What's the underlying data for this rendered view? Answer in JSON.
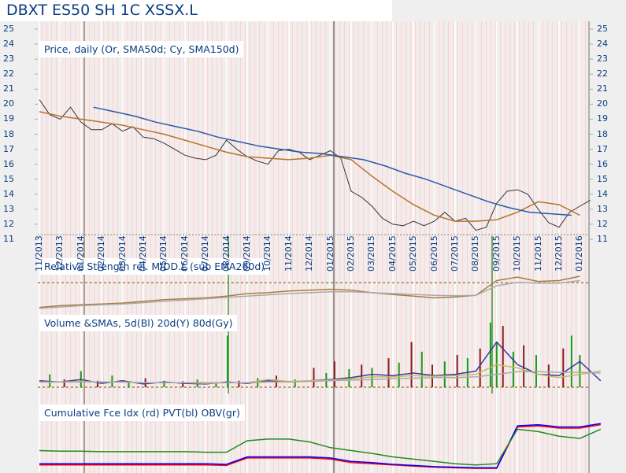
{
  "title": "DBXT ES50 SH 1C XSSX.L",
  "chart_data": [
    {
      "type": "line",
      "title": "Price, daily (Or, SMA50d; Cy, SMA150d)",
      "ylim": [
        11,
        25
      ],
      "yticks": [
        25,
        24,
        23,
        22,
        21,
        20,
        19,
        18,
        17,
        16,
        15,
        14,
        13,
        12,
        11
      ],
      "x_unit": "months since 11/2013",
      "xticks": [
        "11/2013",
        "12/2013",
        "01/2014",
        "02/2014",
        "03/2014",
        "04/2014",
        "05/2014",
        "06/2014",
        "07/2014",
        "08/2014",
        "09/2014",
        "10/2014",
        "11/2014",
        "12/2014",
        "01/2015",
        "02/2015",
        "03/2015",
        "04/2015",
        "05/2015",
        "06/2015",
        "07/2015",
        "08/2015",
        "09/2015",
        "10/2015",
        "11/2015",
        "12/2015",
        "01/2016"
      ],
      "series": [
        {
          "name": "Price",
          "color": "#333333",
          "t_start": 0,
          "t_step": 0.5,
          "values": [
            20.3,
            19.3,
            19.0,
            19.8,
            18.8,
            18.3,
            18.3,
            18.7,
            18.2,
            18.5,
            17.8,
            17.7,
            17.4,
            17.0,
            16.6,
            16.4,
            16.3,
            16.6,
            17.6,
            17.0,
            16.5,
            16.2,
            16.0,
            16.9,
            17.0,
            16.8,
            16.3,
            16.6,
            16.9,
            16.4,
            14.2,
            13.8,
            13.2,
            12.4,
            12.0,
            11.9,
            12.2,
            11.9,
            12.2,
            12.8,
            12.2,
            12.4,
            11.6,
            11.8,
            13.4,
            14.2,
            14.3,
            14.0,
            13.0,
            12.1,
            11.8,
            12.8,
            13.2,
            13.6
          ]
        },
        {
          "name": "SMA50d",
          "color": "#b8732a",
          "t_start": 0,
          "t_step": 1,
          "values": [
            19.5,
            19.2,
            19.0,
            18.8,
            18.6,
            18.3,
            18.0,
            17.6,
            17.2,
            16.8,
            16.5,
            16.4,
            16.3,
            16.4,
            16.6,
            16.3,
            15.2,
            14.2,
            13.3,
            12.6,
            12.2,
            12.2,
            12.3,
            12.8,
            13.5,
            13.3,
            12.6
          ]
        },
        {
          "name": "SMA150d",
          "color": "#2a5aa8",
          "t_start": 2.6,
          "t_step": 1,
          "values": [
            19.8,
            19.5,
            19.2,
            18.8,
            18.5,
            18.2,
            17.8,
            17.5,
            17.2,
            17.0,
            16.8,
            16.7,
            16.5,
            16.3,
            15.9,
            15.4,
            15.0,
            14.5,
            14.0,
            13.5,
            13.1,
            12.8,
            12.7,
            12.6
          ]
        }
      ],
      "reference_line": 11.3
    },
    {
      "type": "line",
      "title": "Relative Strength rel. MIDD.L (sub EMA260d)",
      "ylim": [
        0,
        100
      ],
      "reference_line": 65,
      "series": [
        {
          "name": "RS",
          "color": "#a87c3c",
          "t_start": 0,
          "t_step": 1,
          "values": [
            8,
            12,
            14,
            16,
            18,
            22,
            26,
            28,
            30,
            34,
            40,
            42,
            46,
            48,
            50,
            48,
            42,
            38,
            34,
            30,
            32,
            36,
            70,
            78,
            68,
            70,
            80
          ]
        },
        {
          "name": "EMA260d",
          "color": "#aaaaaa",
          "t_start": 0,
          "t_step": 1,
          "values": [
            6,
            9,
            12,
            14,
            16,
            19,
            22,
            25,
            28,
            31,
            34,
            37,
            40,
            42,
            44,
            44,
            42,
            40,
            38,
            36,
            35,
            36,
            58,
            66,
            64,
            64,
            70
          ]
        }
      ]
    },
    {
      "type": "bar",
      "title": "Volume &SMAs, 5d(Bl) 20d(Y) 80d(Gy)",
      "ylim": [
        0,
        100
      ],
      "bars": [
        [
          0.5,
          20,
          "up"
        ],
        [
          1.2,
          12,
          "down"
        ],
        [
          2.0,
          25,
          "up"
        ],
        [
          2.8,
          10,
          "down"
        ],
        [
          3.5,
          18,
          "up"
        ],
        [
          4.3,
          8,
          "up"
        ],
        [
          5.1,
          14,
          "down"
        ],
        [
          6.0,
          10,
          "up"
        ],
        [
          6.9,
          9,
          "down"
        ],
        [
          7.6,
          12,
          "up"
        ],
        [
          8.5,
          8,
          "up"
        ],
        [
          9.05,
          80,
          "up"
        ],
        [
          9.6,
          10,
          "down"
        ],
        [
          10.5,
          14,
          "up"
        ],
        [
          11.4,
          18,
          "down"
        ],
        [
          12.3,
          12,
          "up"
        ],
        [
          13.2,
          30,
          "down"
        ],
        [
          13.8,
          22,
          "up"
        ],
        [
          14.2,
          40,
          "down"
        ],
        [
          14.9,
          28,
          "up"
        ],
        [
          15.5,
          35,
          "down"
        ],
        [
          16.0,
          30,
          "up"
        ],
        [
          16.8,
          45,
          "down"
        ],
        [
          17.3,
          38,
          "up"
        ],
        [
          17.9,
          70,
          "down"
        ],
        [
          18.4,
          55,
          "up"
        ],
        [
          18.9,
          35,
          "down"
        ],
        [
          19.5,
          40,
          "up"
        ],
        [
          20.1,
          50,
          "down"
        ],
        [
          20.6,
          45,
          "up"
        ],
        [
          21.2,
          60,
          "down"
        ],
        [
          21.7,
          100,
          "up"
        ],
        [
          22.0,
          70,
          "up"
        ],
        [
          22.3,
          95,
          "down"
        ],
        [
          22.8,
          55,
          "up"
        ],
        [
          23.3,
          65,
          "down"
        ],
        [
          23.9,
          50,
          "up"
        ],
        [
          24.5,
          35,
          "down"
        ],
        [
          25.2,
          60,
          "down"
        ],
        [
          25.6,
          80,
          "up"
        ],
        [
          26.0,
          50,
          "up"
        ]
      ],
      "series": [
        {
          "name": "5d",
          "color": "#3a3aa0",
          "t_start": 0,
          "t_step": 1,
          "values": [
            10,
            8,
            12,
            6,
            10,
            5,
            8,
            6,
            5,
            8,
            6,
            10,
            8,
            10,
            12,
            15,
            20,
            18,
            22,
            18,
            20,
            25,
            70,
            35,
            20,
            18,
            40,
            10
          ]
        },
        {
          "name": "20d",
          "color": "#c8b860",
          "t_start": 0,
          "t_step": 1,
          "values": [
            8,
            8,
            9,
            8,
            8,
            7,
            7,
            7,
            6,
            7,
            7,
            12,
            9,
            10,
            11,
            13,
            16,
            16,
            18,
            17,
            18,
            20,
            35,
            30,
            20,
            15,
            20,
            25
          ]
        },
        {
          "name": "80d",
          "color": "#aaaaaa",
          "t_start": 0,
          "t_step": 1,
          "values": [
            8,
            8,
            8,
            8,
            8,
            7,
            7,
            7,
            7,
            7,
            7,
            8,
            8,
            9,
            10,
            11,
            12,
            13,
            14,
            15,
            15,
            16,
            20,
            24,
            24,
            23,
            23,
            22
          ]
        }
      ]
    },
    {
      "type": "line",
      "title": "Cumulative Fce Idx (rd) PVT(bl) OBV(gr)",
      "ylim": [
        0,
        100
      ],
      "series": [
        {
          "name": "Fce Idx",
          "color": "#ff0000",
          "t_start": 0,
          "t_step": 1,
          "values": [
            10,
            10,
            10,
            10,
            10,
            10,
            10,
            10,
            10,
            9,
            22,
            22,
            22,
            22,
            20,
            14,
            12,
            10,
            8,
            6,
            5,
            4,
            4,
            76,
            78,
            74,
            74,
            80
          ]
        },
        {
          "name": "PVT",
          "color": "#0000ff",
          "t_start": 0,
          "t_step": 1,
          "values": [
            12,
            12,
            12,
            12,
            12,
            12,
            12,
            12,
            12,
            11,
            24,
            24,
            24,
            24,
            22,
            16,
            14,
            11,
            9,
            7,
            6,
            5,
            5,
            78,
            80,
            76,
            76,
            82
          ]
        },
        {
          "name": "OBV",
          "color": "#228b22",
          "t_start": 0,
          "t_step": 1,
          "values": [
            35,
            34,
            34,
            33,
            33,
            33,
            33,
            33,
            32,
            32,
            52,
            55,
            55,
            50,
            40,
            35,
            30,
            24,
            20,
            16,
            12,
            10,
            12,
            72,
            68,
            60,
            56,
            72
          ]
        }
      ]
    }
  ]
}
